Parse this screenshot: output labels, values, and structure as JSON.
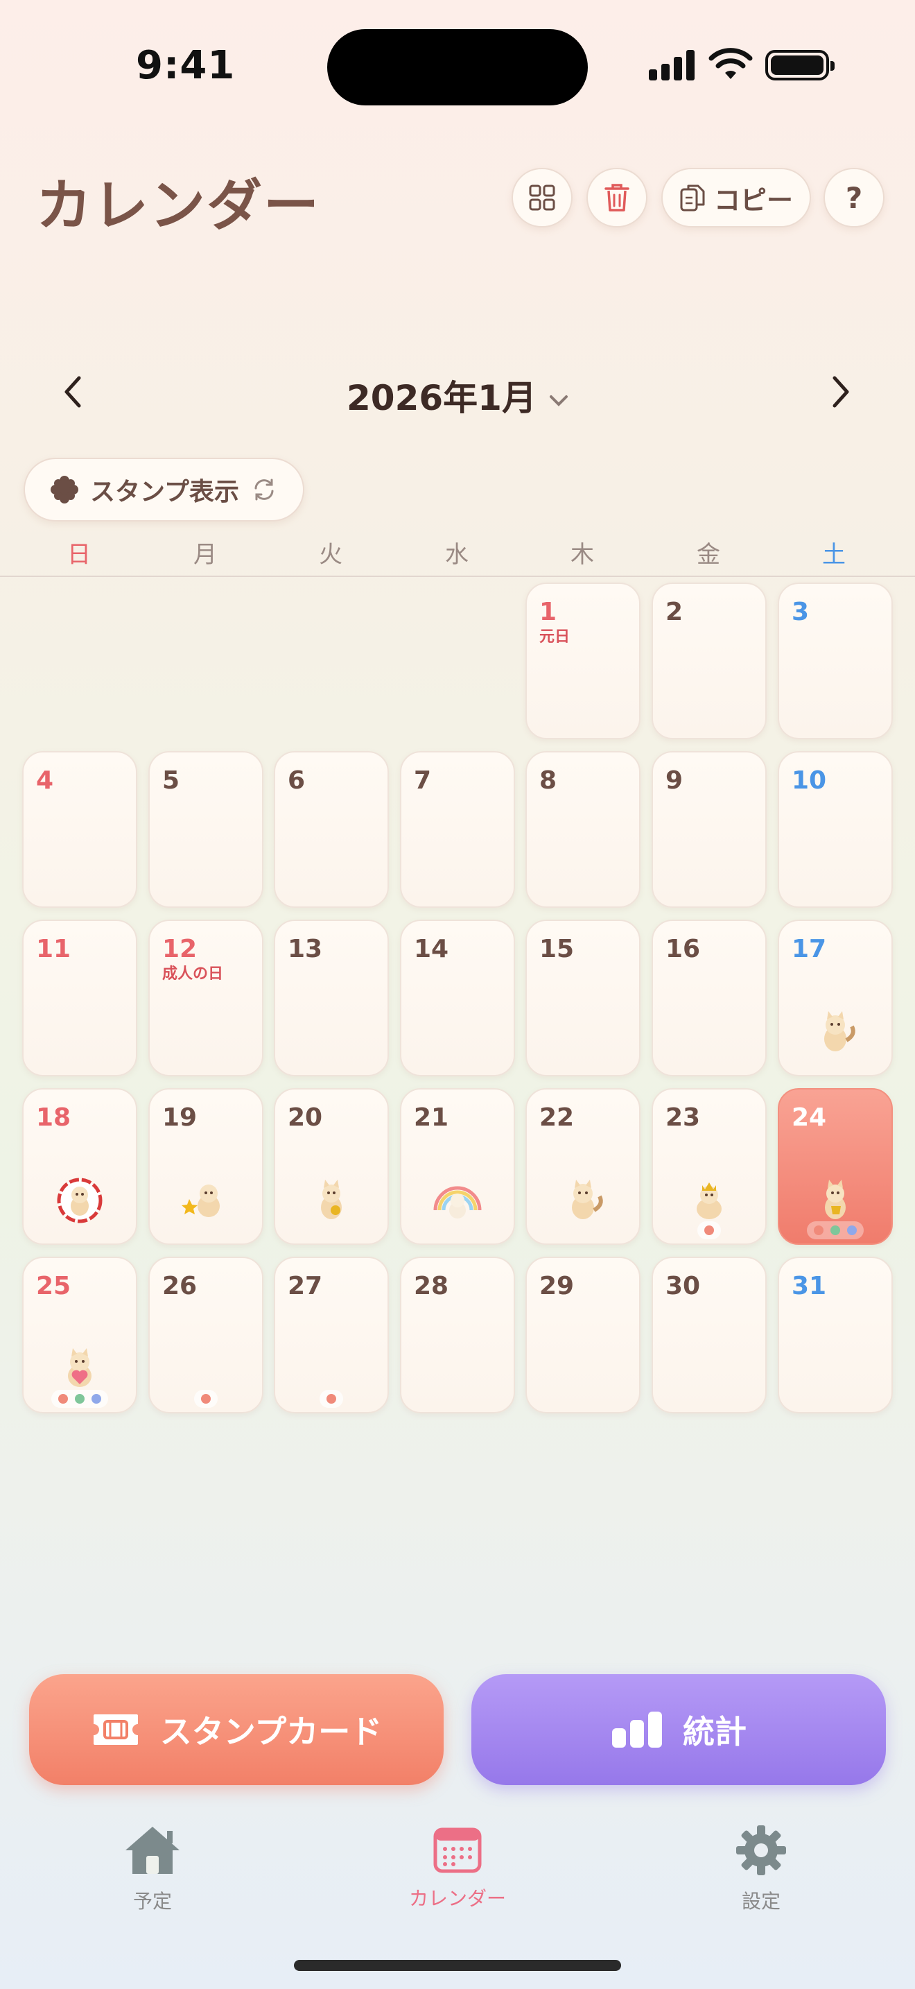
{
  "status_bar": {
    "time": "9:41"
  },
  "header": {
    "title": "カレンダー",
    "copy_label": "コピー",
    "help_label": "?"
  },
  "month_nav": {
    "label": "2026年1月"
  },
  "stamp_toggle": {
    "label": "スタンプ表示"
  },
  "weekdays": [
    "日",
    "月",
    "火",
    "水",
    "木",
    "金",
    "土"
  ],
  "calendar": {
    "days": [
      {
        "num": "1",
        "holiday": "元日"
      },
      {
        "num": "2"
      },
      {
        "num": "3"
      },
      {
        "num": "4"
      },
      {
        "num": "5"
      },
      {
        "num": "6"
      },
      {
        "num": "7"
      },
      {
        "num": "8"
      },
      {
        "num": "9"
      },
      {
        "num": "10"
      },
      {
        "num": "11"
      },
      {
        "num": "12",
        "holiday": "成人の日"
      },
      {
        "num": "13"
      },
      {
        "num": "14"
      },
      {
        "num": "15"
      },
      {
        "num": "16"
      },
      {
        "num": "17"
      },
      {
        "num": "18"
      },
      {
        "num": "19"
      },
      {
        "num": "20"
      },
      {
        "num": "21"
      },
      {
        "num": "22"
      },
      {
        "num": "23"
      },
      {
        "num": "24"
      },
      {
        "num": "25"
      },
      {
        "num": "26"
      },
      {
        "num": "27"
      },
      {
        "num": "28"
      },
      {
        "num": "29"
      },
      {
        "num": "30"
      },
      {
        "num": "31"
      }
    ]
  },
  "buttons": {
    "stamp_card": "スタンプカード",
    "stats": "統計"
  },
  "tabbar": {
    "home": "予定",
    "calendar": "カレンダー",
    "settings": "設定"
  },
  "colors": {
    "sunday": "#e8646a",
    "saturday": "#4a95e6",
    "today": "#f28068",
    "stats_button": "#9678ea",
    "active_tab": "#ec6f86"
  }
}
